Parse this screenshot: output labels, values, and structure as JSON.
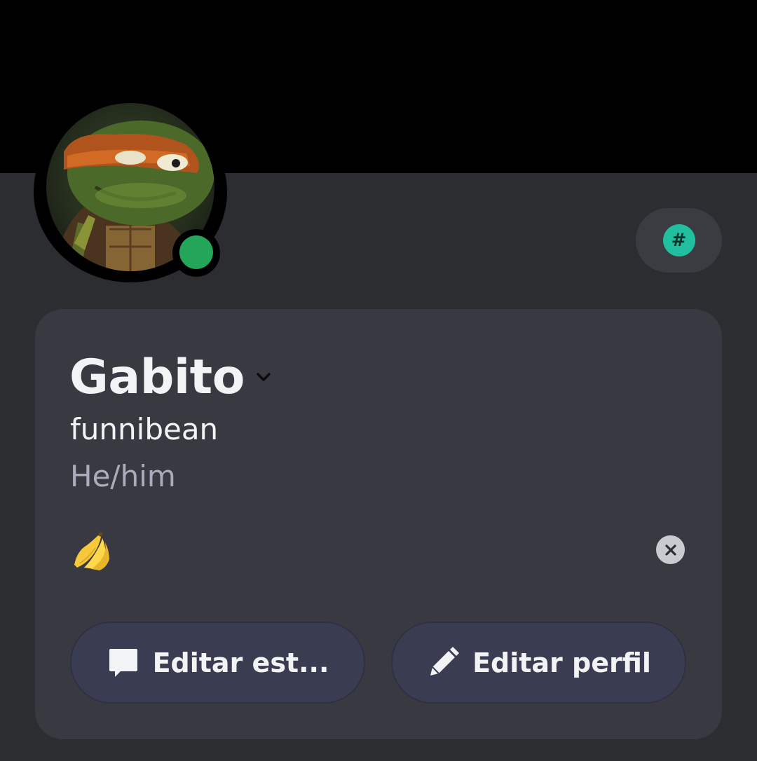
{
  "profile": {
    "display_name": "Gabito",
    "username": "funnibean",
    "pronouns": "He/him",
    "status": {
      "online_state": "online",
      "online_color": "#23a55a",
      "custom_emoji": "banana-emoji"
    },
    "nitro_badge": {
      "symbol": "#",
      "color": "#1fbfa0"
    }
  },
  "actions": {
    "edit_status_label": "Editar est...",
    "edit_status_icon": "speech-bubble-icon",
    "edit_profile_label": "Editar perfil",
    "edit_profile_icon": "pencil-icon"
  },
  "colors": {
    "banner": "#000000",
    "background": "#2b2d31",
    "card": "#393a41",
    "button": "#3a3d52",
    "text_primary": "#f2f3f5",
    "text_muted": "#a9acbb"
  }
}
